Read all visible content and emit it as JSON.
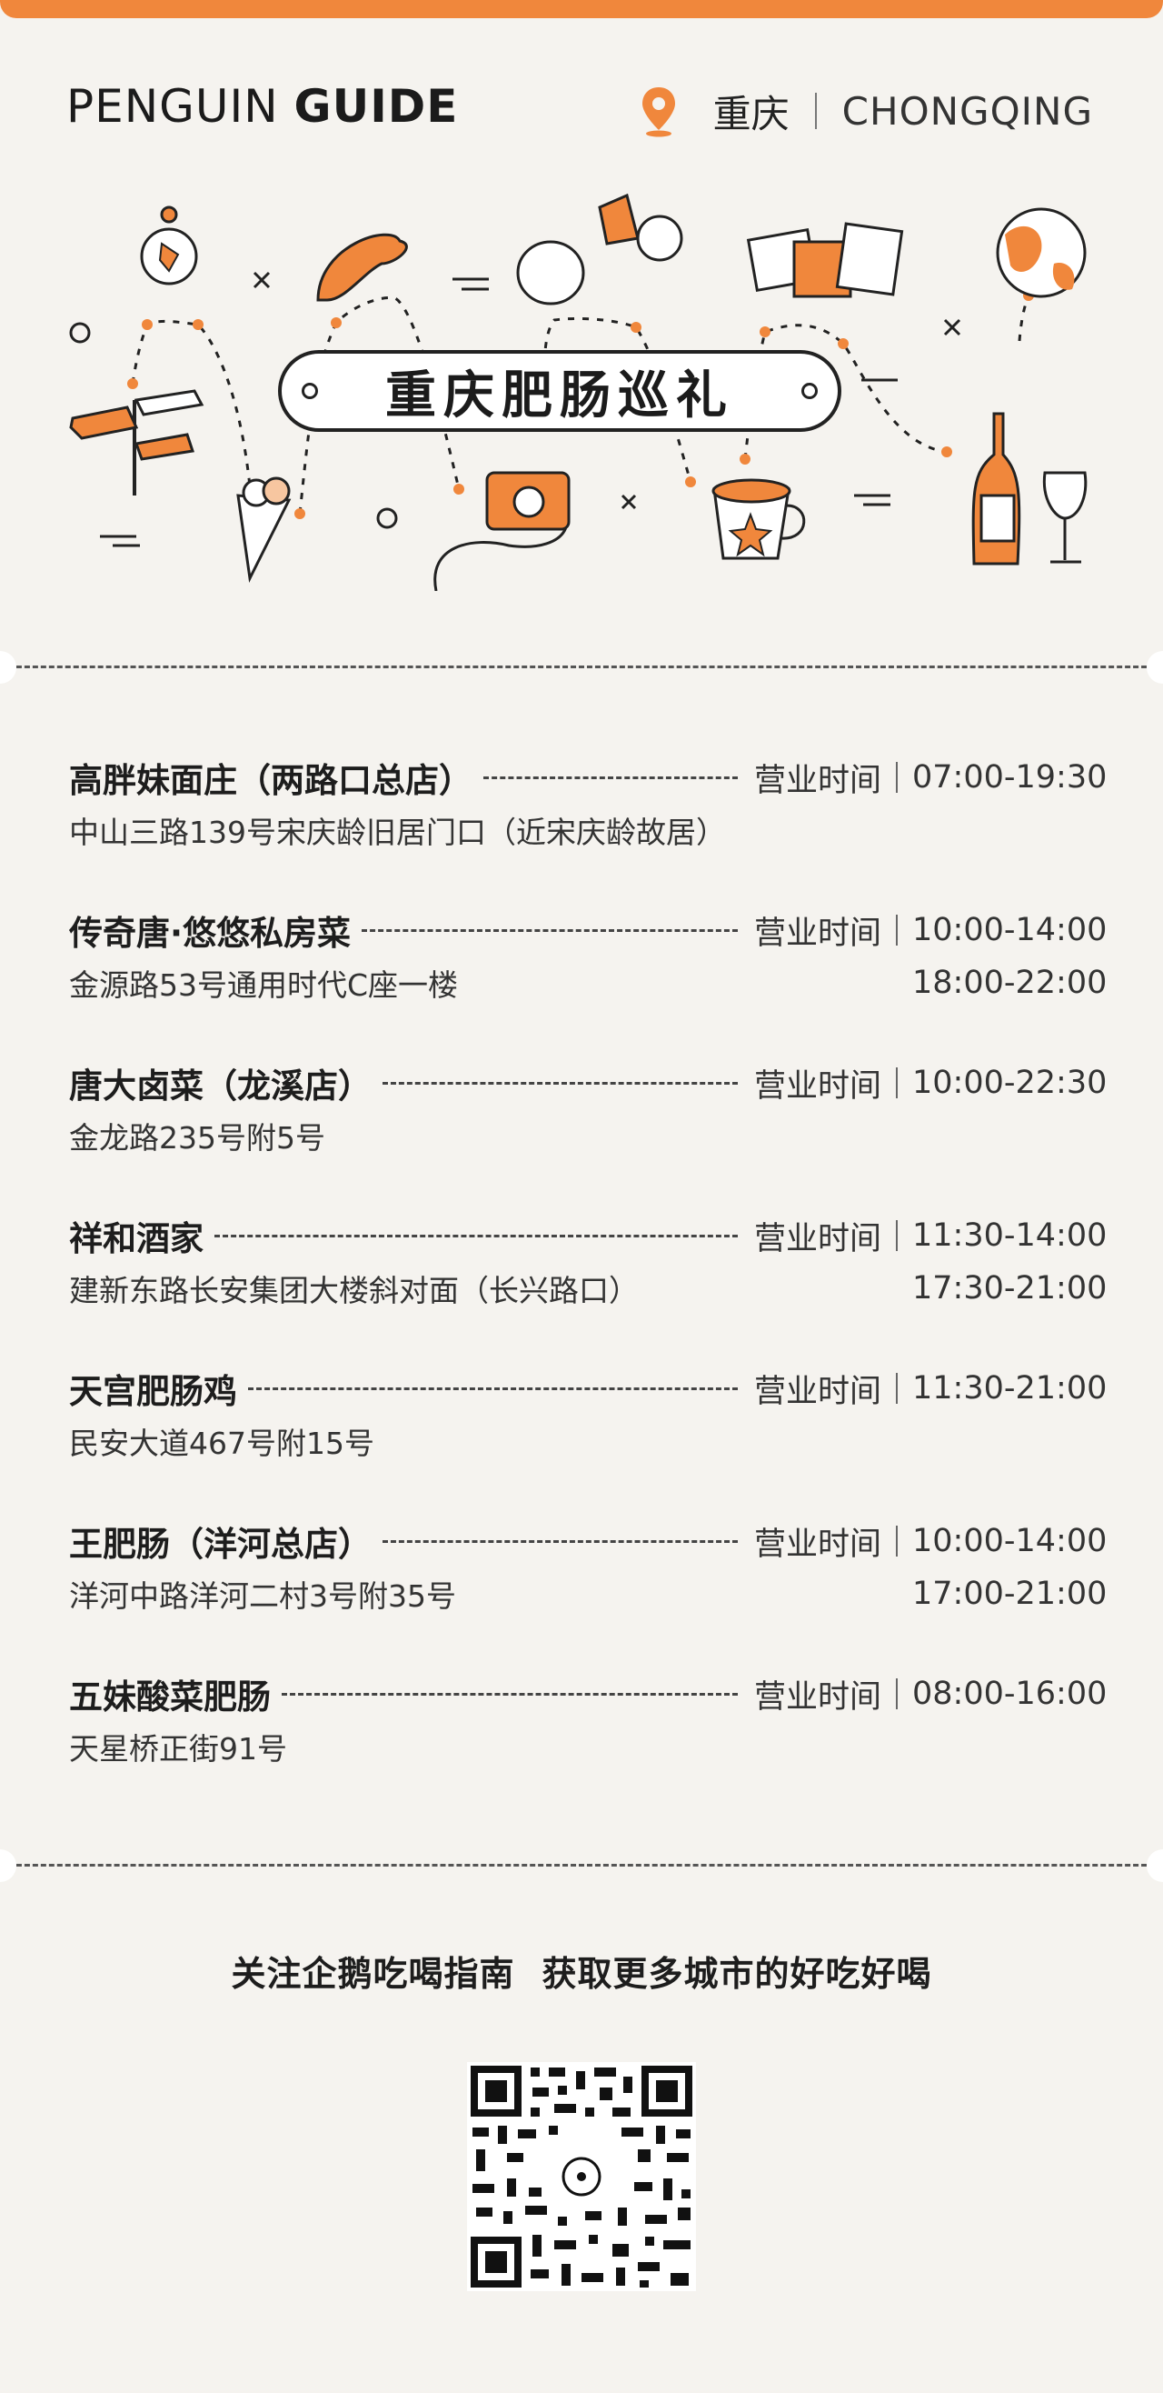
{
  "header": {
    "brand_part1": "PENGUIN",
    "brand_part2": "GUIDE",
    "city": "重庆",
    "city_en": "CHONGQING"
  },
  "hero": {
    "title": "重庆肥肠巡礼"
  },
  "colors": {
    "accent": "#f0873c",
    "background": "#f5f3ef",
    "ink": "#222222"
  },
  "hours_label": "营业时间",
  "restaurants": [
    {
      "name": "高胖妹面庄（两路口总店）",
      "address": "中山三路139号宋庆龄旧居门口（近宋庆龄故居）",
      "hours": [
        "07:00-19:30"
      ]
    },
    {
      "name": "传奇唐·悠悠私房菜",
      "address": "金源路53号通用时代C座一楼",
      "hours": [
        "10:00-14:00",
        "18:00-22:00"
      ]
    },
    {
      "name": "唐大卤菜（龙溪店）",
      "address": "金龙路235号附5号",
      "hours": [
        "10:00-22:30"
      ]
    },
    {
      "name": "祥和酒家",
      "address": "建新东路长安集团大楼斜对面（长兴路口）",
      "hours": [
        "11:30-14:00",
        "17:30-21:00"
      ]
    },
    {
      "name": "天宫肥肠鸡",
      "address": "民安大道467号附15号",
      "hours": [
        "11:30-21:00"
      ]
    },
    {
      "name": "王肥肠（洋河总店）",
      "address": "洋河中路洋河二村3号附35号",
      "hours": [
        "10:00-14:00",
        "17:00-21:00"
      ]
    },
    {
      "name": "五妹酸菜肥肠",
      "address": "天星桥正街91号",
      "hours": [
        "08:00-16:00"
      ]
    }
  ],
  "footer": {
    "follow_text_1": "关注企鹅吃喝指南",
    "follow_text_2": "获取更多城市的好吃好喝",
    "qr_icon": "qr-code-icon"
  }
}
